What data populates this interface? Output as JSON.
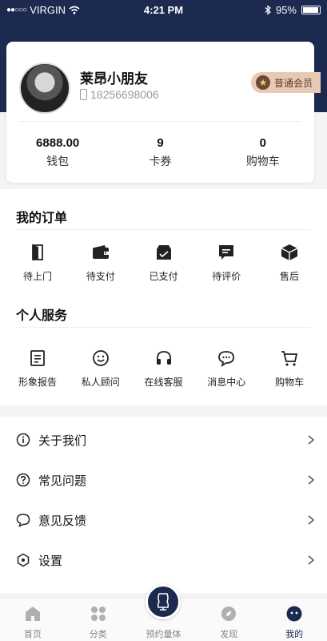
{
  "status_bar": {
    "carrier": "VIRGIN",
    "signal_dots": "●●○○○",
    "time": "4:21 PM",
    "battery": "95%"
  },
  "profile": {
    "name": "莱昂小朋友",
    "phone": "18256698006",
    "member_level": "普通会员"
  },
  "stats": [
    {
      "value": "6888.00",
      "label": "钱包"
    },
    {
      "value": "9",
      "label": "卡券"
    },
    {
      "value": "0",
      "label": "购物车"
    }
  ],
  "orders": {
    "title": "我的订单",
    "items": [
      {
        "label": "待上门",
        "icon": "door-icon"
      },
      {
        "label": "待支付",
        "icon": "wallet-icon"
      },
      {
        "label": "已支付",
        "icon": "paid-box-icon"
      },
      {
        "label": "待评价",
        "icon": "comment-icon"
      },
      {
        "label": "售后",
        "icon": "package-icon"
      }
    ]
  },
  "services": {
    "title": "个人服务",
    "items": [
      {
        "label": "形象报告",
        "icon": "report-icon"
      },
      {
        "label": "私人顾问",
        "icon": "smile-icon"
      },
      {
        "label": "在线客服",
        "icon": "headset-icon"
      },
      {
        "label": "消息中心",
        "icon": "message-icon"
      },
      {
        "label": "购物车",
        "icon": "cart-icon"
      }
    ]
  },
  "menu": [
    {
      "label": "关于我们",
      "icon": "info-icon"
    },
    {
      "label": "常见问题",
      "icon": "question-icon"
    },
    {
      "label": "意见反馈",
      "icon": "feedback-icon"
    },
    {
      "label": "设置",
      "icon": "settings-icon"
    }
  ],
  "tabbar": [
    {
      "label": "首页",
      "icon": "home-icon"
    },
    {
      "label": "分类",
      "icon": "category-icon"
    },
    {
      "label": "预约量体",
      "icon": "tailor-mannequin-icon"
    },
    {
      "label": "发现",
      "icon": "compass-icon"
    },
    {
      "label": "我的",
      "icon": "profile-icon"
    }
  ],
  "colors": {
    "brand_navy": "#1c2a50",
    "badge_bg": "#e8c9b5",
    "badge_text": "#5a3a28"
  }
}
